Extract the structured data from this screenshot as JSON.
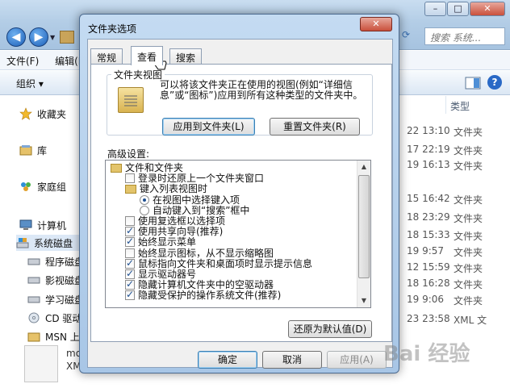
{
  "explorer": {
    "menu": [
      "文件(F)",
      "编辑(E)"
    ],
    "organize_label": "组织 ▾",
    "search_placeholder": "搜索 系统...",
    "nav": {
      "favorites": "收藏夹",
      "libraries": "库",
      "homegroup": "家庭组",
      "computer": "计算机",
      "drives": [
        "系统磁盘",
        "程序磁盘",
        "影视磁盘",
        "学习磁盘",
        "CD 驱动",
        "MSN 上"
      ]
    },
    "column_header": "类型",
    "rows": [
      {
        "date": "22 13:10",
        "type": "文件夹"
      },
      {
        "date": "17 22:19",
        "type": "文件夹"
      },
      {
        "date": "19 16:13",
        "type": "文件夹"
      },
      {
        "date": "15 16:42",
        "type": "文件夹"
      },
      {
        "date": "18 23:29",
        "type": "文件夹"
      },
      {
        "date": "18 15:33",
        "type": "文件夹"
      },
      {
        "date": "19 9:57",
        "type": "文件夹"
      },
      {
        "date": "12 15:59",
        "type": "文件夹"
      },
      {
        "date": "18 16:28",
        "type": "文件夹"
      },
      {
        "date": "19 9:06",
        "type": "文件夹"
      },
      {
        "date": "23 23:58",
        "type": "XML 文"
      }
    ],
    "file_name_line1": "mo",
    "file_name_line2": "XM"
  },
  "dialog": {
    "title": "文件夹选项",
    "tabs": [
      "常规",
      "查看",
      "搜索"
    ],
    "active_tab": "查看",
    "folder_views": {
      "group_label": "文件夹视图",
      "description": "可以将该文件夹正在使用的视图(例如“详细信息”或“图标”)应用到所有这种类型的文件夹中。",
      "apply_button": "应用到文件夹(L)",
      "reset_button": "重置文件夹(R)"
    },
    "advanced_label": "高级设置:",
    "advanced_items": [
      {
        "kind": "folder",
        "indent": 0,
        "label": "文件和文件夹"
      },
      {
        "kind": "check",
        "checked": false,
        "indent": 1,
        "label": "登录时还原上一个文件夹窗口"
      },
      {
        "kind": "folder",
        "indent": 1,
        "label": "键入列表视图时"
      },
      {
        "kind": "radio",
        "checked": true,
        "indent": 2,
        "label": "在视图中选择键入项"
      },
      {
        "kind": "radio",
        "checked": false,
        "indent": 2,
        "label": "自动键入到“搜索”框中"
      },
      {
        "kind": "check",
        "checked": false,
        "indent": 1,
        "label": "使用复选框以选择项"
      },
      {
        "kind": "check",
        "checked": true,
        "indent": 1,
        "label": "使用共享向导(推荐)"
      },
      {
        "kind": "check",
        "checked": true,
        "indent": 1,
        "label": "始终显示菜单"
      },
      {
        "kind": "check",
        "checked": false,
        "indent": 1,
        "label": "始终显示图标，从不显示缩略图"
      },
      {
        "kind": "check",
        "checked": true,
        "indent": 1,
        "label": "鼠标指向文件夹和桌面项时显示提示信息"
      },
      {
        "kind": "check",
        "checked": true,
        "indent": 1,
        "label": "显示驱动器号"
      },
      {
        "kind": "check",
        "checked": true,
        "indent": 1,
        "label": "隐藏计算机文件夹中的空驱动器"
      },
      {
        "kind": "check",
        "checked": true,
        "indent": 1,
        "label": "隐藏受保护的操作系统文件(推荐)"
      }
    ],
    "restore_defaults": "还原为默认值(D)",
    "ok": "确定",
    "cancel": "取消",
    "apply": "应用(A)"
  },
  "watermark": "Bai 经验",
  "colors": {
    "dialog_frame": "#a8c6e6",
    "titlebar": "#b3cde6",
    "close": "#c9503c",
    "check": "#1d4f91"
  }
}
